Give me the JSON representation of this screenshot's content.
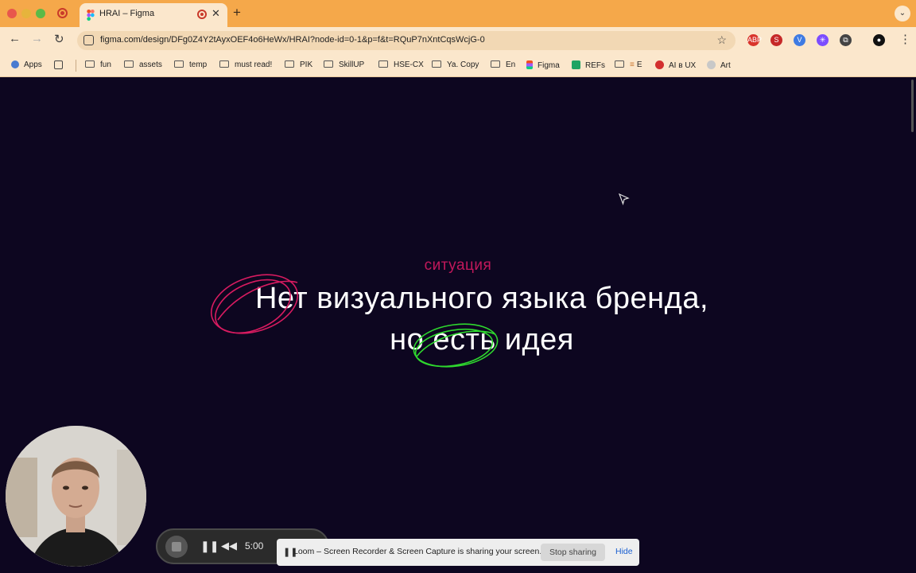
{
  "browser": {
    "tab": {
      "title": "HRAI – Figma",
      "close_glyph": "✕"
    },
    "new_tab_glyph": "+",
    "tab_menu_glyph": "⌄",
    "nav": {
      "back": "←",
      "forward": "→",
      "reload": "↻"
    },
    "url": "figma.com/design/DFg0Z4Y2tAyxOEF4o6HeWx/HRAI?node-id=0-1&p=f&t=RQuP7nXntCqsWcjG-0",
    "star_glyph": "☆",
    "menu_glyph": "⋮",
    "extensions": [
      {
        "name": "abp-extension-icon",
        "color": "#d9342b",
        "text": "ABP"
      },
      {
        "name": "s-extension-icon",
        "color": "#c62828",
        "text": "S"
      },
      {
        "name": "v-extension-icon",
        "color": "#3f7be3",
        "text": "V"
      },
      {
        "name": "sparkle-extension-icon",
        "color": "#7c4dff",
        "text": "✳"
      },
      {
        "name": "puzzle-extension-icon",
        "color": "#444444",
        "text": "⧉"
      },
      {
        "name": "profile-extension-icon",
        "color": "#111111",
        "text": "●"
      }
    ]
  },
  "bookmarks": [
    {
      "label": "Apps",
      "icon": "apps-grid-icon"
    },
    {
      "label": "",
      "icon": "grid-icon"
    },
    {
      "label": "fun",
      "icon": "folder-icon"
    },
    {
      "label": "assets",
      "icon": "folder-icon"
    },
    {
      "label": "temp",
      "icon": "folder-icon"
    },
    {
      "label": "must read!",
      "icon": "folder-icon"
    },
    {
      "label": "PIK",
      "icon": "folder-icon"
    },
    {
      "label": "SkillUP",
      "icon": "folder-icon"
    },
    {
      "label": "HSE-CX",
      "icon": "folder-icon"
    },
    {
      "label": "Ya. Copy",
      "icon": "folder-icon"
    },
    {
      "label": "En",
      "icon": "folder-icon"
    },
    {
      "label": "Figma",
      "icon": "figma-icon"
    },
    {
      "label": "REFs",
      "icon": "sheets-icon"
    },
    {
      "label": "E",
      "icon": "folder-icon"
    },
    {
      "label": "AI в UX",
      "icon": "youtube-icon"
    },
    {
      "label": "Art",
      "icon": "art-icon"
    }
  ],
  "slide": {
    "caption": "ситуация",
    "line1": "Нет визуального языка бренда,",
    "line2": "но есть идея"
  },
  "colors": {
    "background": "#0d0620",
    "caption": "#c2185b",
    "red_scribble": "#d81b60",
    "green_scribble": "#2ed82e"
  },
  "loom": {
    "pause_glyph": "❚❚",
    "rewind_glyph": "◀◀",
    "time": "5:00",
    "share_message": "Loom – Screen Recorder & Screen Capture is sharing your screen.",
    "stop_sharing": "Stop sharing",
    "hide": "Hide"
  }
}
